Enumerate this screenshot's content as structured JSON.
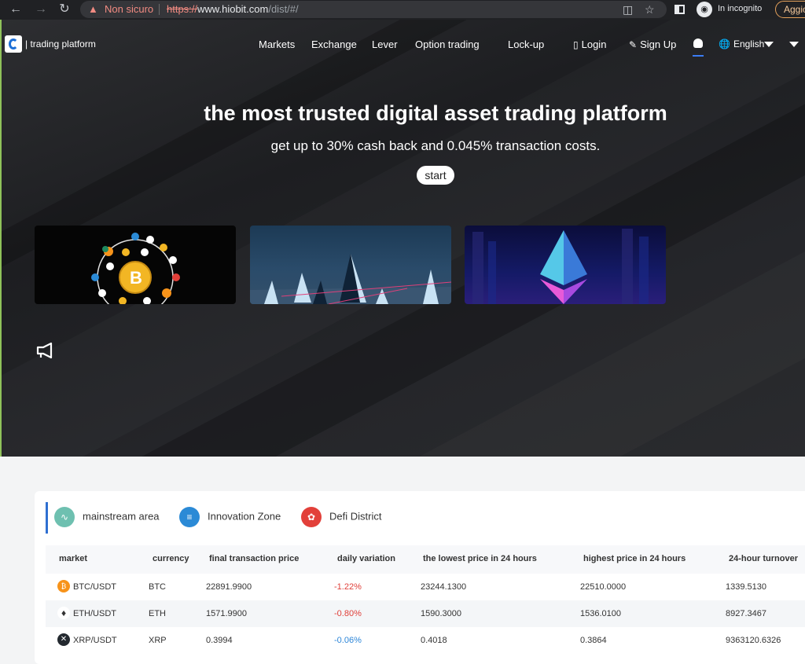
{
  "browser": {
    "security_label": "Non sicuro",
    "url_scheme": "https://",
    "url_host": "www.hiobit.com",
    "url_path": "/dist/#/",
    "incognito_label": "In incognito",
    "update_label": "Aggio"
  },
  "nav": {
    "brand": "| trading platform",
    "links": [
      "Markets",
      "Exchange",
      "Lever",
      "Option trading",
      "Lock-up"
    ],
    "login": "Login",
    "signup": "Sign Up",
    "language": "English"
  },
  "hero": {
    "headline": "the most trusted digital asset trading platform",
    "subline": "get up to 30% cash back and 0.045% transaction costs.",
    "start": "start"
  },
  "market": {
    "tabs": [
      "mainstream area",
      "Innovation Zone",
      "Defi District"
    ],
    "columns": [
      "market",
      "currency",
      "final transaction price",
      "daily variation",
      "the lowest price in 24 hours",
      "highest price in 24 hours",
      "24-hour turnover"
    ],
    "rows": [
      {
        "market": "BTC/USDT",
        "currency": "BTC",
        "price": "22891.9900",
        "variation": "-1.22%",
        "low": "23244.1300",
        "high": "22510.0000",
        "turnover": "1339.5130"
      },
      {
        "market": "ETH/USDT",
        "currency": "ETH",
        "price": "1571.9900",
        "variation": "-0.80%",
        "low": "1590.3000",
        "high": "1536.0100",
        "turnover": "8927.3467"
      },
      {
        "market": "XRP/USDT",
        "currency": "XRP",
        "price": "0.3994",
        "variation": "-0.06%",
        "low": "0.4018",
        "high": "0.3864",
        "turnover": "9363120.6326"
      }
    ]
  },
  "colors": {
    "accent": "#2f6fd1",
    "negative": "#e0403a",
    "negative_small": "#2d86d8"
  }
}
